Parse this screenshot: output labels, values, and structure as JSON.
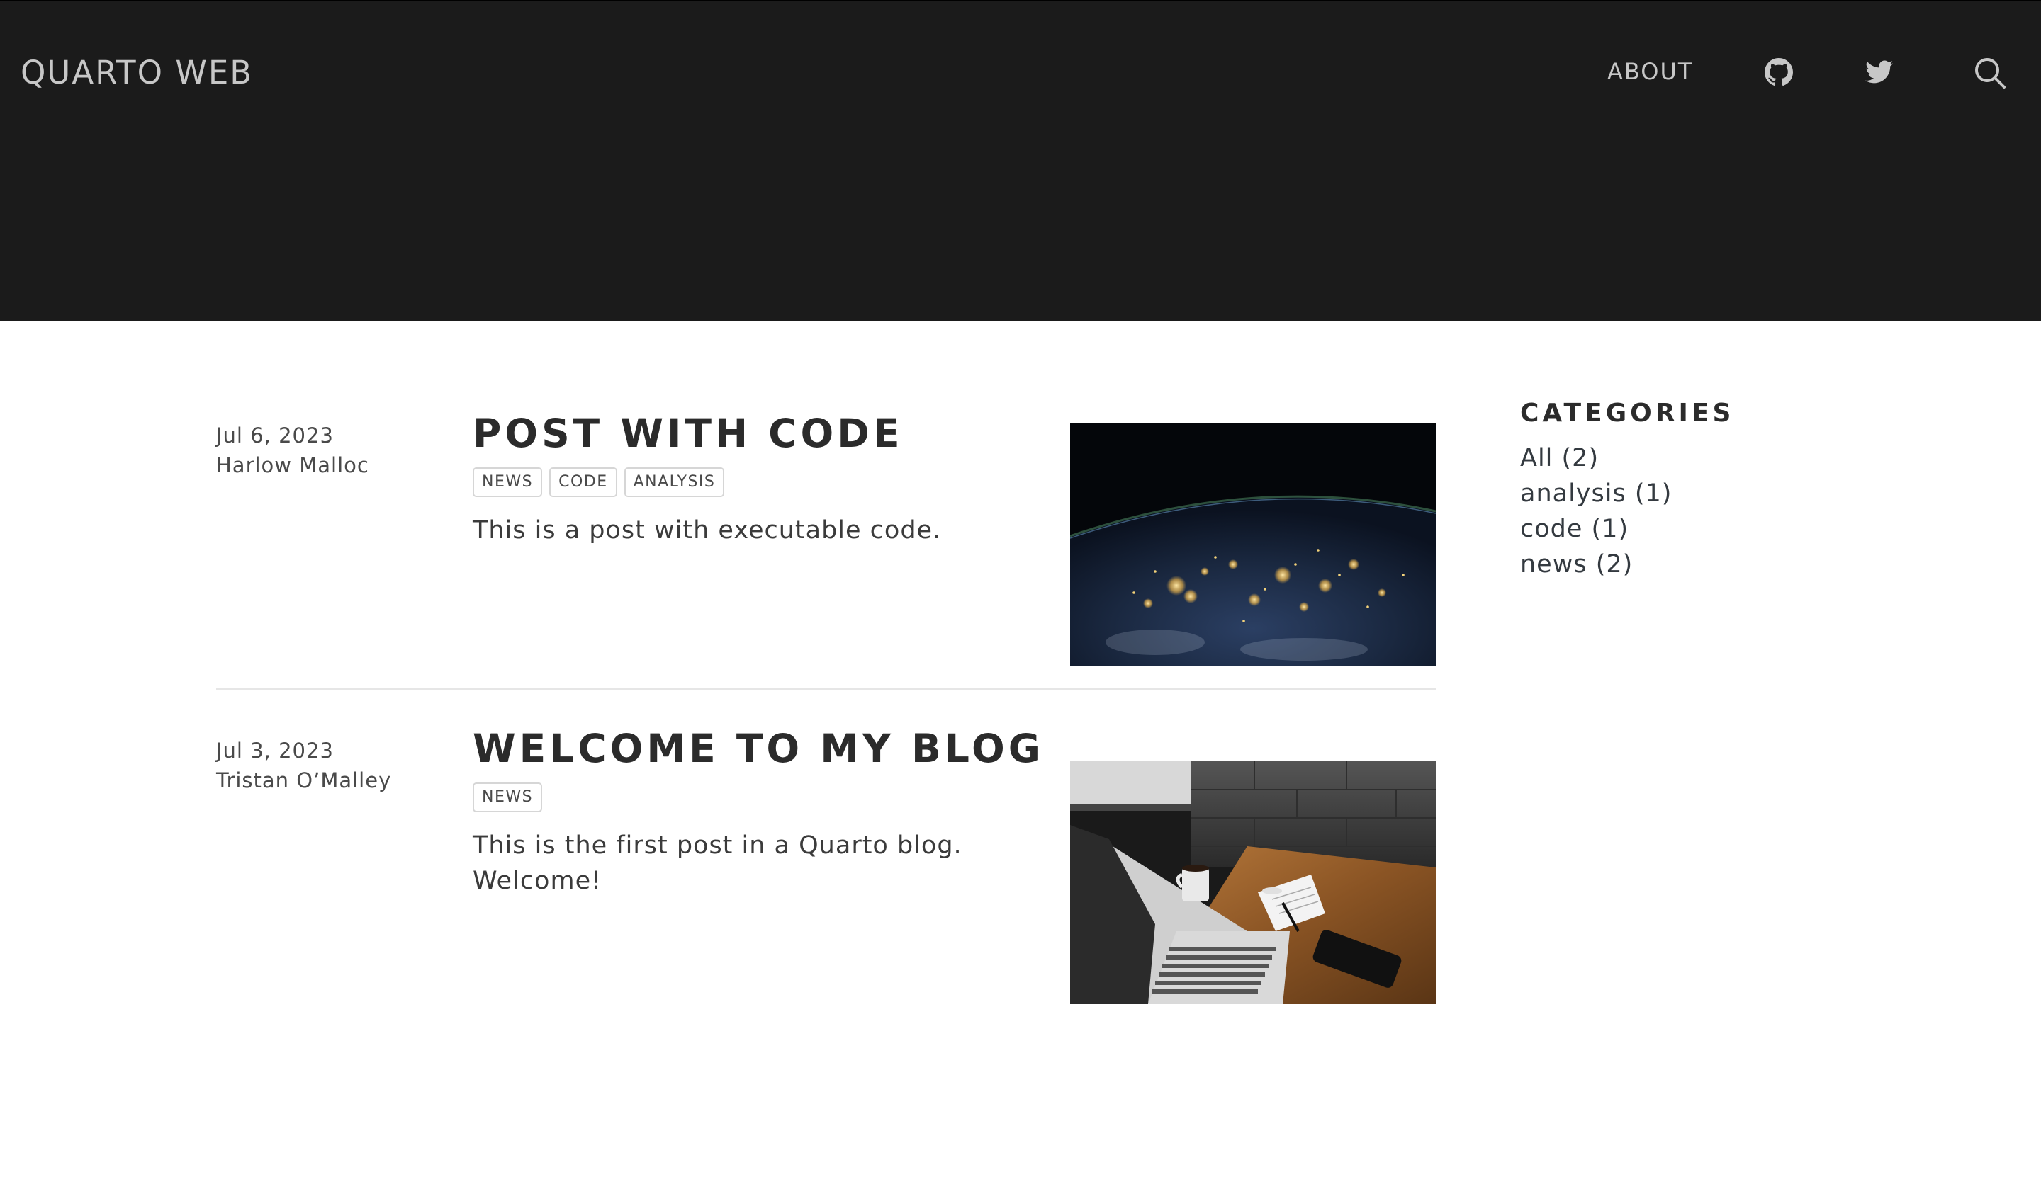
{
  "navbar": {
    "brand": "QUARTO WEB",
    "about_label": "ABOUT",
    "icons": [
      "github-icon",
      "twitter-icon",
      "search-icon"
    ],
    "colors": {
      "background": "#1b1b1b",
      "text": "#c7c7c7"
    }
  },
  "posts": [
    {
      "date": "Jul 6, 2023",
      "author": "Harlow Malloc",
      "title": "POST WITH CODE",
      "tags": [
        "NEWS",
        "CODE",
        "ANALYSIS"
      ],
      "description": "This is a post with executable code.",
      "image": "earth-at-night-image"
    },
    {
      "date": "Jul 3, 2023",
      "author": "Tristan O’Malley",
      "title": "WELCOME TO MY BLOG",
      "tags": [
        "NEWS"
      ],
      "description": "This is the first post in a Quarto blog. Welcome!",
      "image": "laptop-desk-image"
    }
  ],
  "sidebar": {
    "title": "CATEGORIES",
    "items": [
      "All (2)",
      "analysis (1)",
      "code (1)",
      "news (2)"
    ]
  }
}
